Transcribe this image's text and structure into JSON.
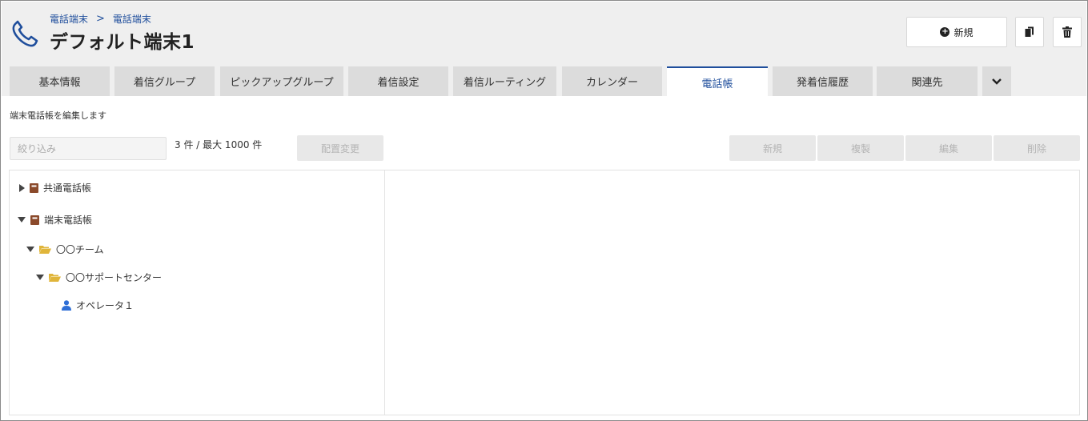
{
  "header": {
    "breadcrumb": [
      "電話端末",
      "電話端末"
    ],
    "breadcrumb_sep": ">",
    "title": "デフォルト端末1",
    "new_button_label": "新規"
  },
  "tabs": [
    {
      "label": "基本情報"
    },
    {
      "label": "着信グループ"
    },
    {
      "label": "ピックアップグループ"
    },
    {
      "label": "着信設定"
    },
    {
      "label": "着信ルーティング"
    },
    {
      "label": "カレンダー"
    },
    {
      "label": "電話帳",
      "active": true
    },
    {
      "label": "発着信履歴"
    },
    {
      "label": "関連先"
    }
  ],
  "content": {
    "description": "端末電話帳を編集します",
    "filter_placeholder": "絞り込み",
    "count_text": "3 件 / 最大 1000 件",
    "rearrange_label": "配置変更",
    "actions": [
      "新規",
      "複製",
      "編集",
      "削除"
    ]
  },
  "tree": {
    "shared_phonebook": "共通電話帳",
    "device_phonebook": "端末電話帳",
    "team": "〇〇チーム",
    "support_center": "〇〇サポートセンター",
    "operator": "オペレータ１"
  },
  "colors": {
    "accent": "#1f4e9c",
    "book": "#8b4a2b",
    "folder": "#e0b53a",
    "user": "#2f6fd6"
  }
}
